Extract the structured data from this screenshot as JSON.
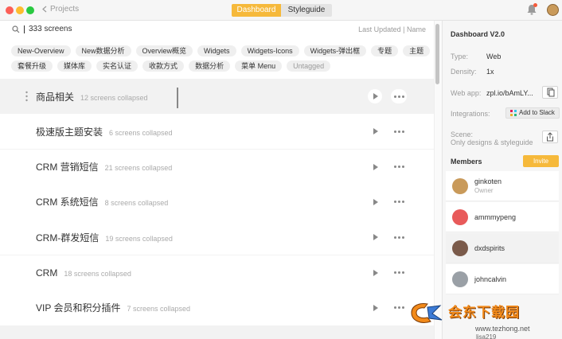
{
  "window": {
    "breadcrumb": "Projects",
    "tabs": [
      "Dashboard",
      "Styleguide"
    ],
    "active_tab": "Dashboard",
    "colors": {
      "accent": "#f6b93b",
      "notification": "#f45a3b"
    }
  },
  "left": {
    "search_value": "333 screens",
    "sort_options": {
      "last_updated": "Last Updated",
      "separator": "|",
      "name": "Name"
    },
    "tags_row1": [
      "New-Overview",
      "New数据分析",
      "Overview概览",
      "Widgets",
      "Widgets-Icons",
      "Widgets-弹出框",
      "专题",
      "主题"
    ],
    "tags_row2": [
      "套餐升级",
      "媒体库",
      "实名认证",
      "收款方式",
      "数据分析",
      "菜单 Menu",
      "Untagged"
    ],
    "sections": [
      {
        "title": "商品相关",
        "count": "12 screens collapsed"
      },
      {
        "title": "极速版主题安装",
        "count": "6 screens collapsed"
      },
      {
        "title": "CRM 营销短信",
        "count": "21 screens collapsed"
      },
      {
        "title": "CRM 系统短信",
        "count": "8 screens collapsed"
      },
      {
        "title": "CRM-群发短信",
        "count": "19 screens collapsed"
      },
      {
        "title": "CRM",
        "count": "18 screens collapsed"
      },
      {
        "title": "VIP 会员和积分插件",
        "count": "7 screens collapsed"
      }
    ]
  },
  "right": {
    "title": "Dashboard V2.0",
    "type_label": "Type:",
    "type_value": "Web",
    "density_label": "Density:",
    "density_value": "1x",
    "webapp_label": "Web app:",
    "webapp_value": "zpl.io/bAmLY...",
    "integrations_label": "Integrations:",
    "slack_button": "Add to Slack",
    "scene_label": "Scene:",
    "scene_value": "Only designs & styleguide",
    "members_label": "Members",
    "invite_button": "Invite",
    "members": [
      {
        "name": "ginkoten",
        "role": "Owner"
      },
      {
        "name": "ammmypeng",
        "role": ""
      },
      {
        "name": "dxdspirits",
        "role": ""
      },
      {
        "name": "johncalvin",
        "role": ""
      },
      {
        "name": "lisa219",
        "role": ""
      }
    ]
  },
  "watermark": {
    "text": "会东下载园",
    "url": "www.tezhong.net"
  }
}
